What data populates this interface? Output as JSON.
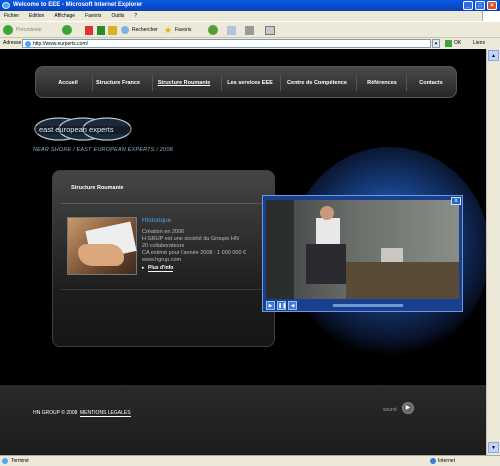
{
  "window": {
    "title": "Welcome to EEE - Microsoft Internet Explorer"
  },
  "menu": [
    "Fichier",
    "Edition",
    "Affichage",
    "Favoris",
    "Outils",
    "?"
  ],
  "toolbar": {
    "back_label": "Précédente",
    "search_label": "Rechercher",
    "favorites_label": "Favoris"
  },
  "address": {
    "label": "Adresse",
    "url": "http://www.eurperts.com/",
    "go_label": "OK",
    "links_label": "Liens"
  },
  "nav": {
    "items": [
      "Accueil",
      "Structure France",
      "Structure Roumanie",
      "Les services EEE",
      "Centre de Compétence",
      "Références",
      "Contacts"
    ],
    "active": "Structure Roumanie"
  },
  "logo": {
    "text": "east european experts",
    "tagline": "NEAR SHORE / EAST EUROPEAN EXPERTS / 2008"
  },
  "panel": {
    "title": "Structure Roumanie",
    "history_title": "Historique",
    "lines": [
      "Création en 2006",
      "H GRUP est une société du Groupe HN",
      "20 collaborateurs",
      "CA estimé pour l'année 2008 : 1 000 000 €",
      "www.hgrup.com"
    ],
    "more_label": "Plus d'info"
  },
  "video": {
    "close_label": "x"
  },
  "footer": {
    "copyright": "HN GROUP  © 2008",
    "legal_label": "MENTIONS LEGALES",
    "sound_label": "sound"
  },
  "status": {
    "left": "Terminé",
    "zone": "Internet"
  }
}
